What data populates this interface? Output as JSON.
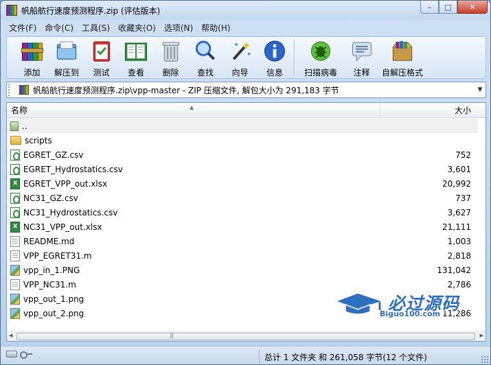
{
  "window": {
    "title": "帆船航行速度预测程序.zip (评估版本)",
    "controls": {
      "minimize": "–",
      "maximize": "□",
      "close": "✕"
    }
  },
  "menu": [
    "文件(F)",
    "命令(C)",
    "工具(S)",
    "收藏夹(O)",
    "选项(N)",
    "帮助(H)"
  ],
  "toolbar": [
    {
      "label": "添加",
      "icon": "books-add-icon"
    },
    {
      "label": "解压到",
      "icon": "folder-extract-icon"
    },
    {
      "label": "测试",
      "icon": "clipboard-check-icon"
    },
    {
      "label": "查看",
      "icon": "open-book-icon"
    },
    {
      "label": "删除",
      "icon": "trash-can-icon"
    },
    {
      "label": "查找",
      "icon": "magnifier-icon"
    },
    {
      "label": "向导",
      "icon": "magic-wand-icon"
    },
    {
      "label": "信息",
      "icon": "info-icon"
    },
    {
      "label": "扫描病毒",
      "icon": "virus-scan-icon"
    },
    {
      "label": "注释",
      "icon": "comment-icon"
    },
    {
      "label": "自解压格式",
      "icon": "sfx-box-icon"
    }
  ],
  "address": {
    "path": "帆船航行速度预测程序.zip\\vpp-master - ZIP 压缩文件, 解包大小为 291,183 字节"
  },
  "columns": {
    "name": "名称",
    "size": "大小"
  },
  "files": [
    {
      "name": "..",
      "size": "",
      "type": "up"
    },
    {
      "name": "scripts",
      "size": "",
      "type": "folder"
    },
    {
      "name": "EGRET_GZ.csv",
      "size": "752",
      "type": "csv"
    },
    {
      "name": "EGRET_Hydrostatics.csv",
      "size": "3,601",
      "type": "csv"
    },
    {
      "name": "EGRET_VPP_out.xlsx",
      "size": "20,992",
      "type": "xlsx"
    },
    {
      "name": "NC31_GZ.csv",
      "size": "737",
      "type": "csv"
    },
    {
      "name": "NC31_Hydrostatics.csv",
      "size": "3,627",
      "type": "csv"
    },
    {
      "name": "NC31_VPP_out.xlsx",
      "size": "21,111",
      "type": "xlsx"
    },
    {
      "name": "README.md",
      "size": "1,003",
      "type": "doc"
    },
    {
      "name": "VPP_EGRET31.m",
      "size": "2,818",
      "type": "doc"
    },
    {
      "name": "vpp_in_1.PNG",
      "size": "131,042",
      "type": "png"
    },
    {
      "name": "VPP_NC31.m",
      "size": "2,786",
      "type": "doc"
    },
    {
      "name": "vpp_out_1.png",
      "size": "",
      "type": "png"
    },
    {
      "name": "vpp_out_2.png",
      "size": "11,286",
      "type": "png"
    }
  ],
  "watermark": {
    "text": "必过源码",
    "sub": "Biguo100.com"
  },
  "status": {
    "summary": "总计 1 文件夹 和 261,058 字节(12 个文件)"
  }
}
